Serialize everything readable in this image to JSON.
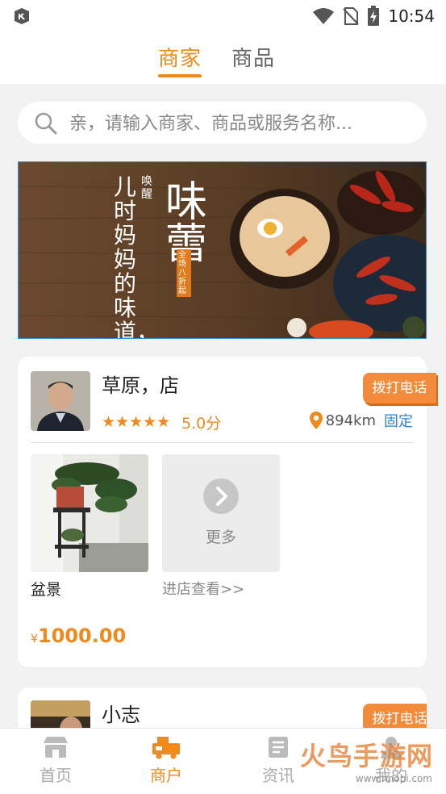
{
  "status_bar": {
    "time": "10:54",
    "app_icon": "notification-app-icon",
    "icons": [
      "wifi-icon",
      "no-sim-icon",
      "battery-charging-icon"
    ]
  },
  "header": {
    "tabs": [
      {
        "label": "商家",
        "active": true
      },
      {
        "label": "商品",
        "active": false
      }
    ],
    "accent_color": "#f08a1c"
  },
  "search": {
    "placeholder": "亲，请输入商家、商品或服务名称..."
  },
  "banner": {
    "text_lines": [
      "儿时妈妈的味道，",
      "唤醒",
      "味蕾",
      "全场八折起"
    ]
  },
  "shops": [
    {
      "name": "草原，店",
      "stars": "★★★★★",
      "score": "5.0分",
      "call_label": "拨打电话",
      "distance": "894km",
      "location_type": "固定",
      "product_name": "盆景",
      "more_label": "更多",
      "enter_label": "进店查看>>",
      "price_symbol": "¥",
      "price": "1000.00"
    },
    {
      "name": "小志",
      "call_label": "拨打电话"
    }
  ],
  "tabbar": {
    "items": [
      {
        "label": "首页",
        "icon": "store-front-icon",
        "active": false
      },
      {
        "label": "商户",
        "icon": "merchant-truck-icon",
        "active": true
      },
      {
        "label": "资讯",
        "icon": "news-document-icon",
        "active": false
      },
      {
        "label": "我的",
        "icon": "profile-icon",
        "active": false
      }
    ]
  },
  "watermark": {
    "text": "火鸟手游网",
    "url_text": "www.hnopi.com"
  }
}
